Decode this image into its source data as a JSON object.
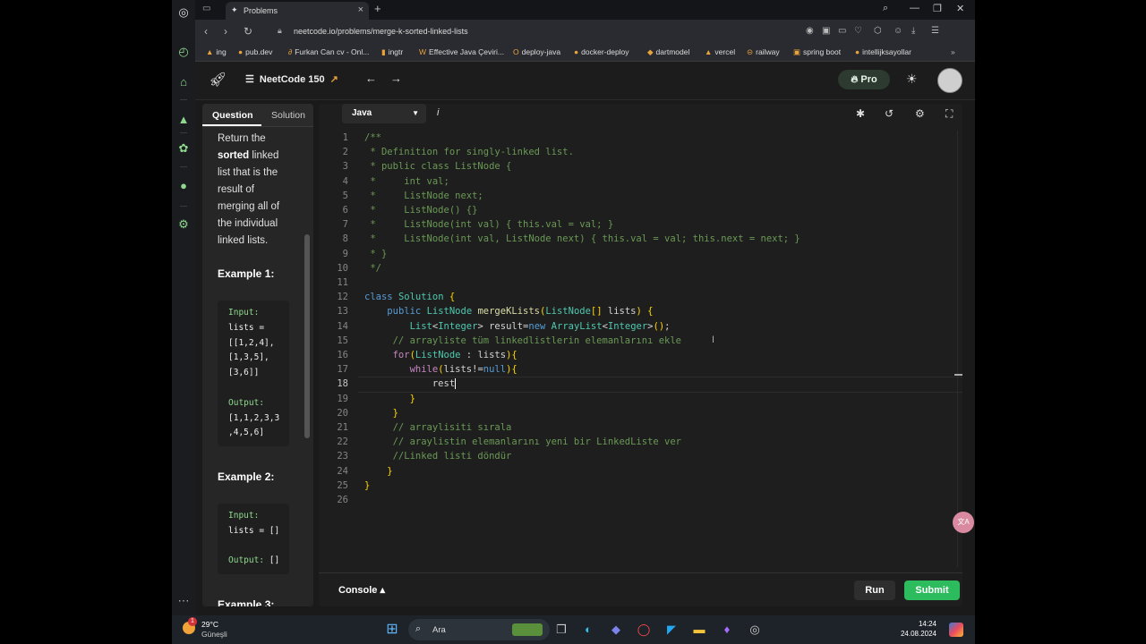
{
  "browser": {
    "tab_title": "Problems",
    "url": "neetcode.io/problems/merge-k-sorted-linked-lists",
    "bookmarks": [
      "ing",
      "pub.dev",
      "Furkan Can cv - Onl...",
      "ingtr",
      "Effective Java Çeviri...",
      "deploy-java",
      "docker-deploy",
      "dartmodel",
      "vercel",
      "railway",
      "spring boot",
      "intellijksayollar"
    ]
  },
  "header": {
    "list_title": "NeetCode 150",
    "pro_label": "Pro"
  },
  "question": {
    "tabs": [
      "Question",
      "Solution"
    ],
    "text_pre": "Return the",
    "text_bold": "sorted",
    "text_post": " linked list that is the result of merging all of the individual linked lists.",
    "example1": {
      "title": "Example 1:",
      "input_label": "Input:",
      "input_lines": [
        "lists =",
        "[[1,2,4],",
        "[1,3,5],",
        "[3,6]]"
      ],
      "output_label": "Output:",
      "output_lines": [
        "[1,1,2,3,3",
        ",4,5,6]"
      ]
    },
    "example2": {
      "title": "Example 2:",
      "input_label": "Input:",
      "input_lines": [
        "lists = []"
      ],
      "output_label": "Output:",
      "output_value": "[]"
    },
    "example3_title": "Example 3:"
  },
  "editor": {
    "language": "Java",
    "info_label": "i",
    "current_line": 18,
    "typed_text": "rest",
    "lines": [
      "/**",
      " * Definition for singly-linked list.",
      " * public class ListNode {",
      " *     int val;",
      " *     ListNode next;",
      " *     ListNode() {}",
      " *     ListNode(int val) { this.val = val; }",
      " *     ListNode(int val, ListNode next) { this.val = val; this.next = next; }",
      " * }",
      " */",
      "",
      "class Solution {",
      "    public ListNode mergeKLists(ListNode[] lists) {",
      "        List<Integer> result=new ArrayList<Integer>();",
      "     // arrayliste tüm linkedlistlerin elemanlarını ekle",
      "     for(ListNode : lists){",
      "        while(lists!=null){",
      "            rest",
      "        }",
      "     }",
      "     // arraylisiti sırala",
      "     // araylistin elemanlarını yeni bir LinkedListe ver",
      "     //Linked listi döndür",
      "    }",
      "}",
      ""
    ]
  },
  "footer": {
    "console_label": "Console",
    "run_label": "Run",
    "submit_label": "Submit"
  },
  "taskbar": {
    "temperature": "29°C",
    "weather": "Güneşli",
    "notif_count": "1",
    "search_label": "Ara",
    "time": "14:24",
    "date": "24.08.2024"
  }
}
